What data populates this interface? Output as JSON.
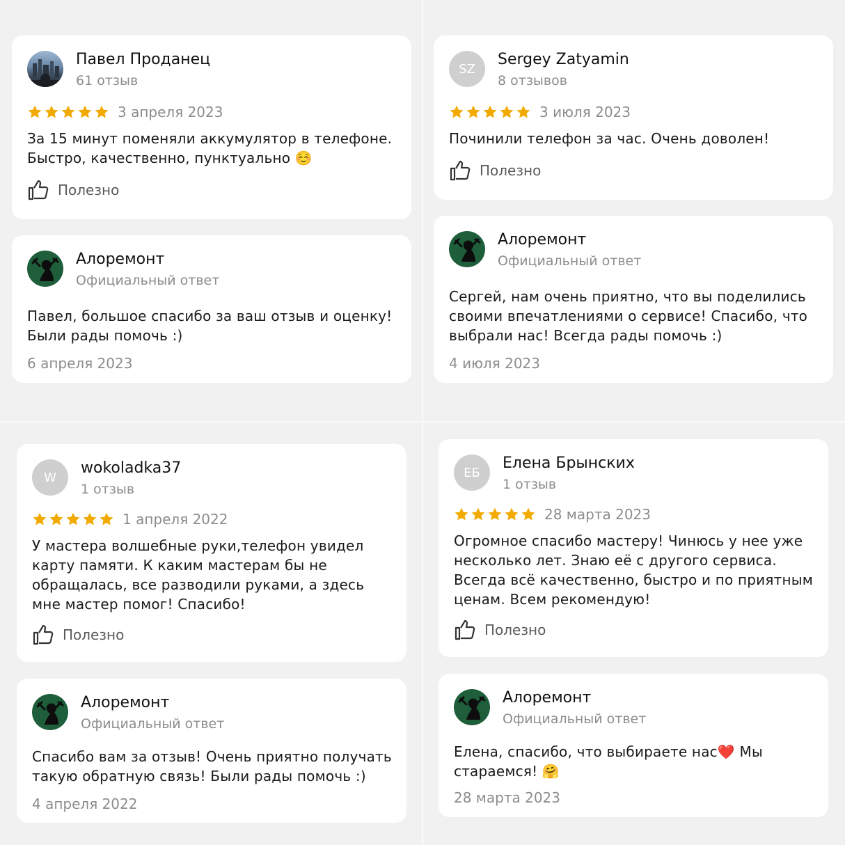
{
  "common": {
    "helpful_label": "Полезно",
    "official_label": "Официальный ответ",
    "brand_name": "Алоремонт"
  },
  "reviews": [
    {
      "author": "Павел Проданец",
      "count": "61 отзыв",
      "stars": 5,
      "date": "3 апреля 2023",
      "text": "За 15 минут поменяли аккумулятор в телефоне. Быстро, качественно, пунктуально ☺️",
      "reply_text": "Павел, большое спасибо за ваш отзыв и оценку! Были рады помочь :)",
      "reply_date": "6 апреля 2023"
    },
    {
      "author": "Sergey Zatyamin",
      "initials": "SZ",
      "count": "8 отзывов",
      "stars": 5,
      "date": "3 июля 2023",
      "text": "Починили телефон за час. Очень доволен!",
      "reply_text": "Сергей, нам очень приятно, что вы поделились своими впечатлениями о сервисе! Спасибо, что выбрали нас! Всегда рады помочь :)",
      "reply_date": "4 июля 2023"
    },
    {
      "author": "wokoladka37",
      "initials": "W",
      "count": "1 отзыв",
      "stars": 5,
      "date": "1 апреля 2022",
      "text": "У мастера волшебные руки,телефон увидел карту памяти. К каким мастерам бы не обращалась, все разводили руками, а здесь мне мастер помог! Спасибо!",
      "reply_text": "Спасибо вам за отзыв! Очень приятно получать такую обратную связь! Были рады помочь :)",
      "reply_date": "4 апреля 2022"
    },
    {
      "author": "Елена Брынских",
      "initials": "ЕБ",
      "count": "1 отзыв",
      "stars": 5,
      "date": "28 марта 2023",
      "text": "Огромное спасибо мастеру! Чинюсь у нее уже несколько лет. Знаю её с другого сервиса. Всегда всё качественно, быстро и по приятным ценам. Всем рекомендую!",
      "reply_text": "Елена, спасибо, что выбираете нас❤️ Мы стараемся! 🤗",
      "reply_date": "28 марта 2023"
    }
  ],
  "colors": {
    "star": "#f2a900",
    "brand_avatar": "#1e5e3a",
    "background": "#f1f1f1",
    "muted_text": "#8c8c8c"
  },
  "icons": [
    "star-icon",
    "thumbs-up-icon",
    "aloremont-logo-icon"
  ]
}
